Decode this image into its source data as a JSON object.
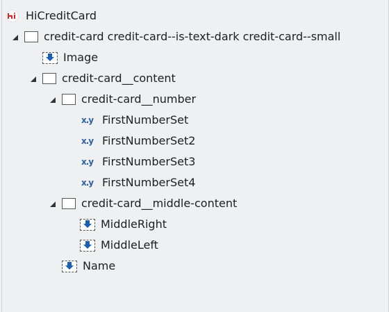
{
  "tree": {
    "root": {
      "label": "HiCreditCard",
      "icon": "hi-app-icon"
    },
    "nodes": [
      {
        "label": "credit-card credit-card--is-text-dark  credit-card--small",
        "icon": "container-icon"
      },
      {
        "label": "Image",
        "icon": "image-icon"
      },
      {
        "label": "credit-card__content",
        "icon": "container-icon"
      },
      {
        "label": "credit-card__number",
        "icon": "container-icon"
      },
      {
        "label": "FirstNumberSet",
        "icon": "expression-icon",
        "icon_text": "x.y"
      },
      {
        "label": "FirstNumberSet2",
        "icon": "expression-icon",
        "icon_text": "x.y"
      },
      {
        "label": "FirstNumberSet3",
        "icon": "expression-icon",
        "icon_text": "x.y"
      },
      {
        "label": "FirstNumberSet4",
        "icon": "expression-icon",
        "icon_text": "x.y"
      },
      {
        "label": "credit-card__middle-content",
        "icon": "container-icon"
      },
      {
        "label": "MiddleRight",
        "icon": "image-icon"
      },
      {
        "label": "MiddleLeft",
        "icon": "image-icon"
      },
      {
        "label": "Name",
        "icon": "image-icon"
      }
    ]
  },
  "colors": {
    "background": "#eef0f2",
    "brand_red": "#d9242b",
    "icon_blue": "#1a5fb4",
    "expression_blue": "#2e5f9f"
  }
}
